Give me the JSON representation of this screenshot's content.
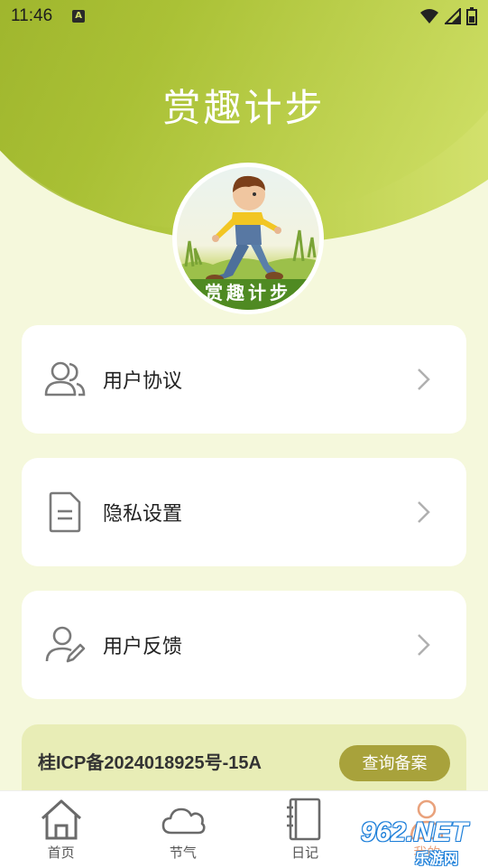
{
  "status_bar": {
    "time": "11:46",
    "notification_badge": "A"
  },
  "header": {
    "title": "赏趣计步",
    "avatar_banner": "赏趣计步"
  },
  "menu": [
    {
      "label": "用户协议",
      "icon": "users-icon"
    },
    {
      "label": "隐私设置",
      "icon": "document-icon"
    },
    {
      "label": "用户反馈",
      "icon": "user-edit-icon"
    }
  ],
  "icp": {
    "text": "桂ICP备2024018925号-15A",
    "button_label": "查询备案"
  },
  "nav": [
    {
      "label": "首页",
      "icon": "home-icon"
    },
    {
      "label": "节气",
      "icon": "cloud-icon"
    },
    {
      "label": "日记",
      "icon": "notebook-icon"
    },
    {
      "label": "我的",
      "icon": "profile-icon"
    }
  ],
  "watermark": {
    "main": "962.NET",
    "sub": "乐游网"
  },
  "colors": {
    "accent": "#a8a23b",
    "header_green": "#9cb42a",
    "page_bg": "#f5f8dc",
    "icp_bg": "#e8edb6",
    "active_nav": "#e9a27c"
  }
}
